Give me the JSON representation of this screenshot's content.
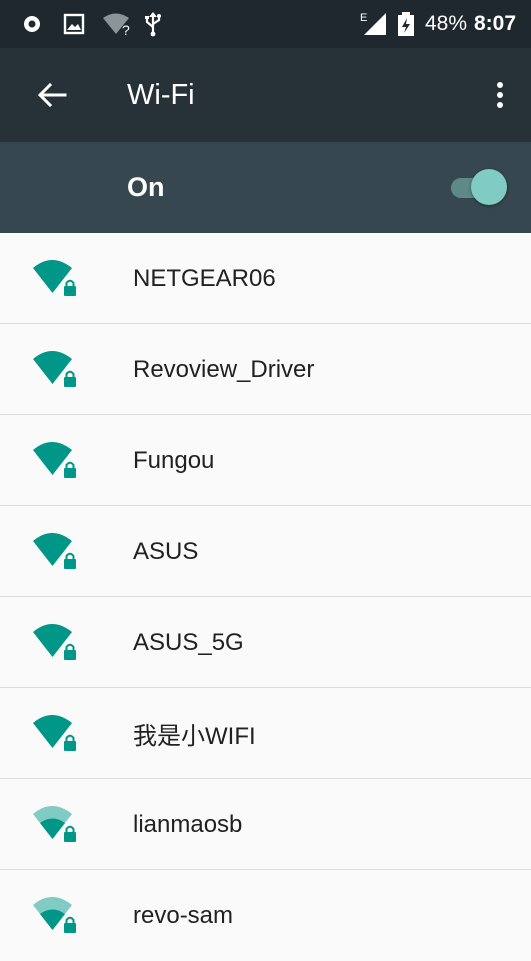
{
  "status_bar": {
    "battery": "48%",
    "time": "8:07",
    "signal_label": "E"
  },
  "app_bar": {
    "title": "Wi-Fi"
  },
  "master_switch": {
    "label": "On",
    "state": "on"
  },
  "colors": {
    "accent": "#009688",
    "accent_light": "#80cbc4",
    "toolbar": "#263238",
    "switch_bar": "#37474f"
  },
  "networks": [
    {
      "ssid": "NETGEAR06",
      "signal": "full",
      "secured": true
    },
    {
      "ssid": "Revoview_Driver",
      "signal": "full",
      "secured": true
    },
    {
      "ssid": "Fungou",
      "signal": "full",
      "secured": true
    },
    {
      "ssid": "ASUS",
      "signal": "full",
      "secured": true
    },
    {
      "ssid": "ASUS_5G",
      "signal": "full",
      "secured": true
    },
    {
      "ssid": "我是小WIFI",
      "signal": "full",
      "secured": true
    },
    {
      "ssid": "lianmaosb",
      "signal": "medium",
      "secured": true
    },
    {
      "ssid": "revo-sam",
      "signal": "medium",
      "secured": true
    }
  ]
}
